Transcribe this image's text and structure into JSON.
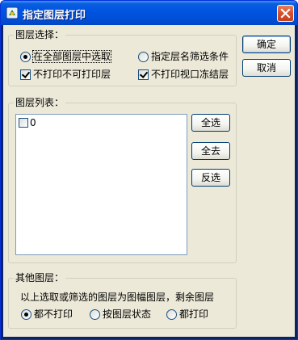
{
  "window": {
    "title": "指定图层打印"
  },
  "buttons": {
    "ok": "确定",
    "cancel": "取消",
    "select_all": "全选",
    "clear_all": "全去",
    "invert": "反选"
  },
  "layer_selection": {
    "label": "图层选择：",
    "option_all": "在全部图层中选取",
    "option_filter": "指定层名筛选条件",
    "chk_no_unprintable": "不打印不可打印层",
    "chk_no_frozen_viewport": "不打印视口冻结层",
    "selected": "all"
  },
  "layer_list": {
    "label": "图层列表：",
    "items": [
      {
        "name": "0",
        "checked": false
      }
    ]
  },
  "other_layers": {
    "label": "其他图层：",
    "description": "以上选取或筛选的图层为图幅图层，剩余图层",
    "option_none": "都不打印",
    "option_state": "按图层状态",
    "option_all": "都打印",
    "selected": "none"
  }
}
